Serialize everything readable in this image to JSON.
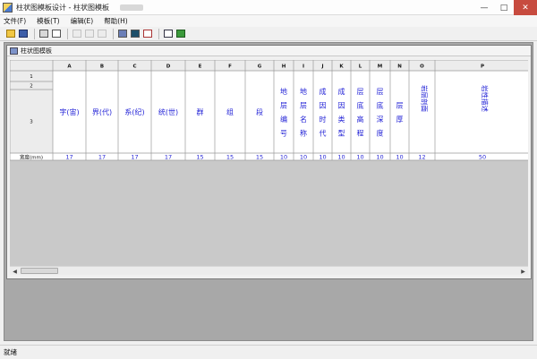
{
  "window": {
    "title": "柱状图模板设计 - 柱状图模板"
  },
  "menu": [
    "文件(F)",
    "模板(T)",
    "编辑(E)",
    "帮助(H)"
  ],
  "toolbar": {
    "icons": [
      "open-icon",
      "save-icon",
      "print-icon",
      "print-preview-icon",
      "cut-icon",
      "copy-icon",
      "paste-icon",
      "table-icon",
      "layout-icon",
      "edit-tool-icon",
      "help-icon",
      "about-icon"
    ]
  },
  "child": {
    "title": "柱状图模板"
  },
  "grid": {
    "column_letters": [
      "A",
      "B",
      "C",
      "D",
      "E",
      "F",
      "G",
      "H",
      "I",
      "J",
      "K",
      "L",
      "M",
      "N",
      "O",
      "P"
    ],
    "row_numbers": [
      "1",
      "2",
      "3"
    ],
    "headers": [
      "字(宙)",
      "界(代)",
      "系(纪)",
      "统(世)",
      "群",
      "组",
      "段",
      "地层编号",
      "地层名称",
      "成因时代",
      "成因类型",
      "层底高程",
      "层底深度",
      "层厚",
      "岩层剖面",
      "岩性描述"
    ],
    "width_label": "宽度(mm)",
    "widths": [
      "17",
      "17",
      "17",
      "17",
      "15",
      "15",
      "15",
      "10",
      "10",
      "10",
      "10",
      "10",
      "10",
      "10",
      "12",
      "50"
    ]
  },
  "status": {
    "text": "就绪"
  },
  "colors": {
    "header_text": "#1f1fd6",
    "gridline": "#9a9a9a",
    "mdi_bg": "#a8a8a8"
  }
}
